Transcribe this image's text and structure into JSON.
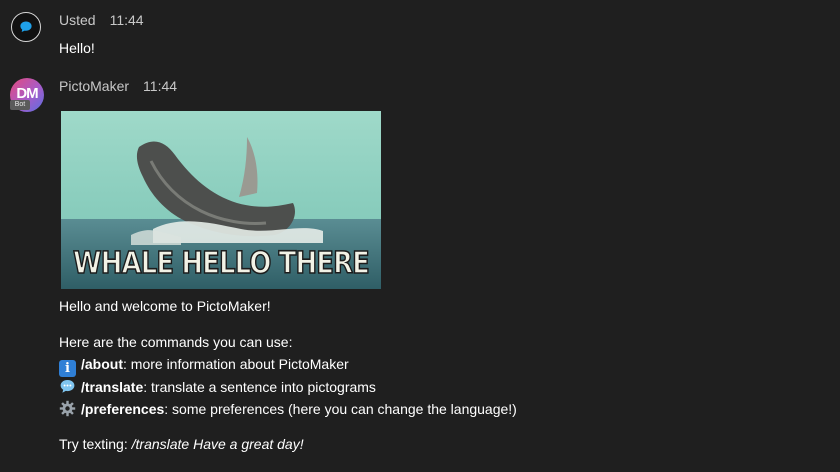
{
  "messages": [
    {
      "sender": "Usted",
      "time": "11:44",
      "text": "Hello!",
      "avatar_icon": "chat-bubble-icon"
    },
    {
      "sender": "PictoMaker",
      "time": "11:44",
      "avatar_initials": "DM",
      "badge": "Bot",
      "image_caption": "WHALE HELLO THERE",
      "welcome": "Hello and welcome to PictoMaker!",
      "commands_intro": "Here are the commands you can use:",
      "commands": [
        {
          "icon": "information-icon",
          "name": "/about",
          "desc": ": more information about PictoMaker"
        },
        {
          "icon": "speech-balloon-icon",
          "name": "/translate",
          "desc": ": translate a sentence into pictograms"
        },
        {
          "icon": "gear-icon",
          "name": "/preferences",
          "desc": ": some preferences (here you can change the language!)"
        }
      ],
      "try_prefix": "Try texting: ",
      "try_example": "/translate Have a great day!"
    }
  ],
  "colors": {
    "background": "#1f1f1f",
    "muted_text": "#c8c8c8",
    "info_blue": "#2f7fd6"
  }
}
